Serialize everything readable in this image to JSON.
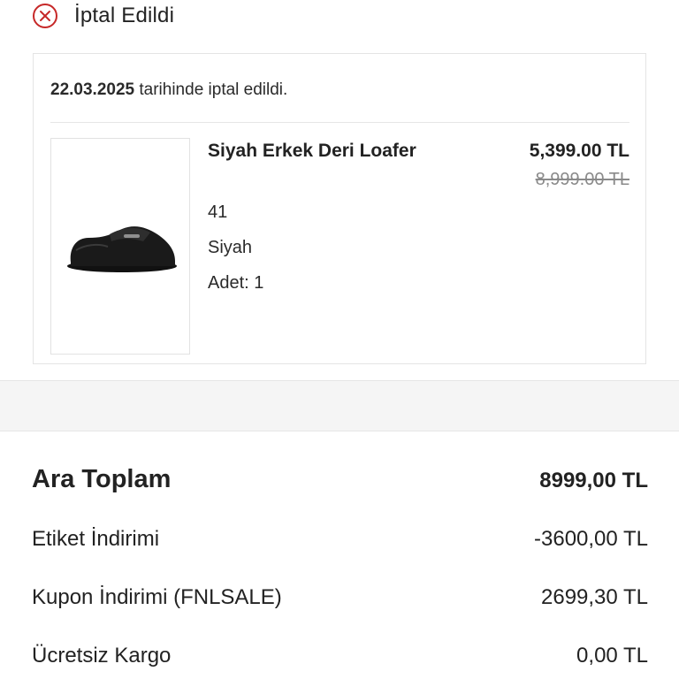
{
  "status": {
    "title": "İptal Edildi",
    "icon": "cancel-circle-icon",
    "color": "#c62828"
  },
  "order": {
    "cancel_date": "22.03.2025",
    "cancel_text": " tarihinde iptal edildi.",
    "product": {
      "name": "Siyah Erkek Deri Loafer",
      "price": "5,399.00 TL",
      "old_price": "8,999.00 TL",
      "size": "41",
      "color": "Siyah",
      "quantity": "Adet: 1",
      "image": "black-leather-loafer-image"
    }
  },
  "summary": {
    "subtotal_label": "Ara Toplam",
    "subtotal_value": "8999,00 TL",
    "tag_discount_label": "Etiket İndirimi",
    "tag_discount_value": "-3600,00 TL",
    "coupon_discount_label": "Kupon İndirimi (FNLSALE)",
    "coupon_discount_value": "2699,30 TL",
    "shipping_label": "Ücretsiz Kargo",
    "shipping_value": "0,00 TL"
  }
}
